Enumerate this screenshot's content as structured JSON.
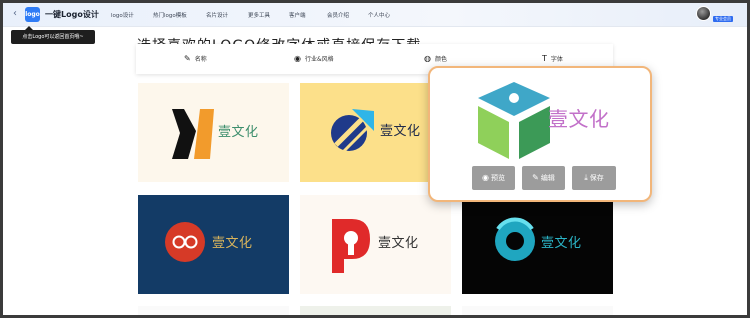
{
  "topbar": {
    "back_icon": "‹",
    "logo_text": "logo",
    "brand": "一键Logo设计",
    "nav": [
      "logo设计",
      "热门logo模板",
      "名片设计",
      "更多工具",
      "客户端",
      "会员介绍",
      "个人中心"
    ],
    "vip_badge": "专业会员"
  },
  "tooltip": "点击Logo可以返回首页哦~",
  "heading": "选择喜欢的LOGO修改字体或直接保存下载",
  "filters": [
    {
      "label": "名称",
      "icon": "pen-icon",
      "glyph": "✎"
    },
    {
      "label": "行业&风格",
      "icon": "target-icon",
      "glyph": "◉"
    },
    {
      "label": "颜色",
      "icon": "palette-icon",
      "glyph": "◍"
    },
    {
      "label": "字体",
      "icon": "font-icon",
      "glyph": "T"
    }
  ],
  "cards": [
    {
      "name": "壹文化",
      "bg": "#fdf7ec",
      "text_color": "#3c8e6c"
    },
    {
      "name": "壹文化",
      "bg": "#fce08a",
      "text_color": "#1f3a8a"
    },
    {
      "name": "壹文化",
      "bg": "#133b66",
      "text_color": "#d9b45c"
    },
    {
      "name": "壹文化",
      "bg": "#fdf8f2",
      "text_color": "#333333"
    },
    {
      "name": "壹文化",
      "bg": "#050505",
      "text_color": "#2bb5c7"
    }
  ],
  "popover": {
    "name": "壹文化",
    "text_color": "#c271c9",
    "buttons": [
      {
        "label": "预览",
        "icon": "eye-icon",
        "glyph": "◉"
      },
      {
        "label": "编辑",
        "icon": "edit-icon",
        "glyph": "✎"
      },
      {
        "label": "保存",
        "icon": "download-icon",
        "glyph": "⤓"
      }
    ]
  },
  "colors": {
    "accent": "#2f7cf6",
    "popover_border": "#f2b67a",
    "button_gray": "#9c9c9c"
  }
}
